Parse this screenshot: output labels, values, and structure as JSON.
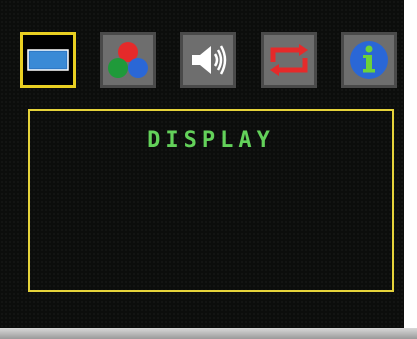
{
  "menu": {
    "tabs": [
      {
        "id": "display",
        "icon": "display-icon",
        "selected": true
      },
      {
        "id": "color",
        "icon": "color-icon",
        "selected": false
      },
      {
        "id": "audio",
        "icon": "speaker-icon",
        "selected": false
      },
      {
        "id": "input",
        "icon": "input-switch-icon",
        "selected": false
      },
      {
        "id": "information",
        "icon": "info-icon",
        "selected": false
      }
    ]
  },
  "panel": {
    "title": "DISPLAY"
  },
  "colors": {
    "selection_border": "#e9cf22",
    "panel_border": "#e5d23a",
    "title_text": "#63d15a",
    "background": "#0c0d0c"
  }
}
